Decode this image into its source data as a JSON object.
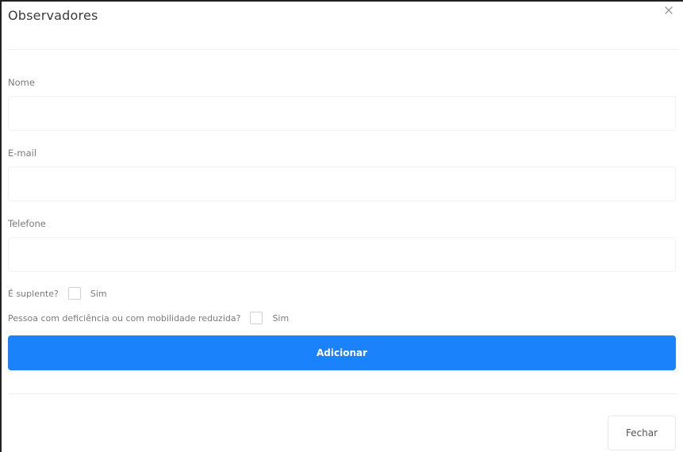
{
  "modal": {
    "title": "Observadores",
    "close_icon": "close-icon"
  },
  "form": {
    "name_label": "Nome",
    "name_value": "",
    "email_label": "E-mail",
    "email_value": "",
    "phone_label": "Telefone",
    "phone_value": "",
    "substitute_label": "É suplente?",
    "substitute_option": "Sim",
    "substitute_checked": false,
    "disability_label": "Pessoa com deficiência ou com mobilidade reduzida?",
    "disability_option": "Sim",
    "disability_checked": false
  },
  "actions": {
    "add_label": "Adicionar",
    "close_label": "Fechar",
    "primary_color": "#1a82fb"
  }
}
